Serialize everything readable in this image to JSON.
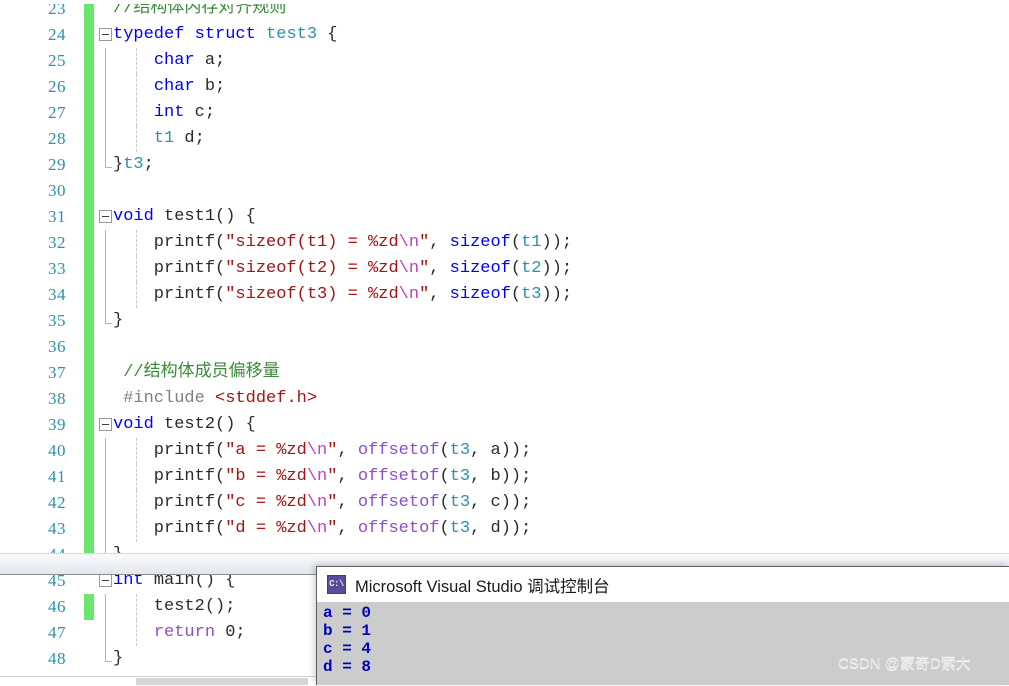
{
  "editor": {
    "first_visible_line": 23,
    "lines": [
      {
        "n": 23,
        "changed": true,
        "fold": false,
        "rail": "none",
        "guide": false,
        "tokens": [
          {
            "t": "//结构体内存对齐规则",
            "c": "cmt"
          }
        ],
        "indent": 0
      },
      {
        "n": 24,
        "changed": true,
        "fold": true,
        "rail": "none",
        "guide": false,
        "tokens": [
          {
            "t": "typedef",
            "c": "kw"
          },
          {
            "t": " ",
            "c": "pln"
          },
          {
            "t": "struct",
            "c": "kw"
          },
          {
            "t": " ",
            "c": "pln"
          },
          {
            "t": "test3",
            "c": "typ"
          },
          {
            "t": " {",
            "c": "pln"
          }
        ],
        "indent": 0
      },
      {
        "n": 25,
        "changed": true,
        "fold": false,
        "rail": "mid",
        "guide": true,
        "tokens": [
          {
            "t": "    ",
            "c": "pln"
          },
          {
            "t": "char",
            "c": "kw"
          },
          {
            "t": " a;",
            "c": "pln"
          }
        ],
        "indent": 0
      },
      {
        "n": 26,
        "changed": true,
        "fold": false,
        "rail": "mid",
        "guide": true,
        "tokens": [
          {
            "t": "    ",
            "c": "pln"
          },
          {
            "t": "char",
            "c": "kw"
          },
          {
            "t": " b;",
            "c": "pln"
          }
        ],
        "indent": 0
      },
      {
        "n": 27,
        "changed": true,
        "fold": false,
        "rail": "mid",
        "guide": true,
        "tokens": [
          {
            "t": "    ",
            "c": "pln"
          },
          {
            "t": "int",
            "c": "kw"
          },
          {
            "t": " c;",
            "c": "pln"
          }
        ],
        "indent": 0
      },
      {
        "n": 28,
        "changed": true,
        "fold": false,
        "rail": "mid",
        "guide": true,
        "tokens": [
          {
            "t": "    ",
            "c": "pln"
          },
          {
            "t": "t1",
            "c": "typ"
          },
          {
            "t": " d;",
            "c": "pln"
          }
        ],
        "indent": 0
      },
      {
        "n": 29,
        "changed": true,
        "fold": false,
        "rail": "end",
        "guide": false,
        "tokens": [
          {
            "t": "}",
            "c": "pln"
          },
          {
            "t": "t3",
            "c": "typ"
          },
          {
            "t": ";",
            "c": "pln"
          }
        ],
        "indent": 0
      },
      {
        "n": 30,
        "changed": true,
        "fold": false,
        "rail": "none",
        "guide": false,
        "tokens": [],
        "indent": 0
      },
      {
        "n": 31,
        "changed": true,
        "fold": true,
        "rail": "none",
        "guide": false,
        "tokens": [
          {
            "t": "void",
            "c": "kw"
          },
          {
            "t": " ",
            "c": "pln"
          },
          {
            "t": "test1",
            "c": "pln"
          },
          {
            "t": "() {",
            "c": "pln"
          }
        ],
        "indent": 0
      },
      {
        "n": 32,
        "changed": true,
        "fold": false,
        "rail": "mid",
        "guide": true,
        "tokens": [
          {
            "t": "    printf(",
            "c": "pln"
          },
          {
            "t": "\"sizeof(t1) = %zd",
            "c": "str"
          },
          {
            "t": "\\n",
            "c": "esc"
          },
          {
            "t": "\"",
            "c": "str"
          },
          {
            "t": ", ",
            "c": "pln"
          },
          {
            "t": "sizeof",
            "c": "kw"
          },
          {
            "t": "(",
            "c": "pln"
          },
          {
            "t": "t1",
            "c": "typ"
          },
          {
            "t": "));",
            "c": "pln"
          }
        ],
        "indent": 0
      },
      {
        "n": 33,
        "changed": true,
        "fold": false,
        "rail": "mid",
        "guide": true,
        "tokens": [
          {
            "t": "    printf(",
            "c": "pln"
          },
          {
            "t": "\"sizeof(t2) = %zd",
            "c": "str"
          },
          {
            "t": "\\n",
            "c": "esc"
          },
          {
            "t": "\"",
            "c": "str"
          },
          {
            "t": ", ",
            "c": "pln"
          },
          {
            "t": "sizeof",
            "c": "kw"
          },
          {
            "t": "(",
            "c": "pln"
          },
          {
            "t": "t2",
            "c": "typ"
          },
          {
            "t": "));",
            "c": "pln"
          }
        ],
        "indent": 0
      },
      {
        "n": 34,
        "changed": true,
        "fold": false,
        "rail": "mid",
        "guide": true,
        "tokens": [
          {
            "t": "    printf(",
            "c": "pln"
          },
          {
            "t": "\"sizeof(t3) = %zd",
            "c": "str"
          },
          {
            "t": "\\n",
            "c": "esc"
          },
          {
            "t": "\"",
            "c": "str"
          },
          {
            "t": ", ",
            "c": "pln"
          },
          {
            "t": "sizeof",
            "c": "kw"
          },
          {
            "t": "(",
            "c": "pln"
          },
          {
            "t": "t3",
            "c": "typ"
          },
          {
            "t": "));",
            "c": "pln"
          }
        ],
        "indent": 0
      },
      {
        "n": 35,
        "changed": true,
        "fold": false,
        "rail": "end",
        "guide": false,
        "tokens": [
          {
            "t": "}",
            "c": "pln"
          }
        ],
        "indent": 0
      },
      {
        "n": 36,
        "changed": true,
        "fold": false,
        "rail": "none",
        "guide": false,
        "tokens": [],
        "indent": 0
      },
      {
        "n": 37,
        "changed": true,
        "fold": false,
        "rail": "none",
        "guide": false,
        "tokens": [
          {
            "t": " //结构体成员偏移量",
            "c": "cmt"
          }
        ],
        "indent": 0
      },
      {
        "n": 38,
        "changed": true,
        "fold": false,
        "rail": "none",
        "guide": false,
        "tokens": [
          {
            "t": " #include",
            "c": "pre"
          },
          {
            "t": " <stddef.h>",
            "c": "prehdr"
          }
        ],
        "indent": 0
      },
      {
        "n": 39,
        "changed": true,
        "fold": true,
        "rail": "none",
        "guide": false,
        "tokens": [
          {
            "t": "void",
            "c": "kw"
          },
          {
            "t": " ",
            "c": "pln"
          },
          {
            "t": "test2",
            "c": "pln"
          },
          {
            "t": "() {",
            "c": "pln"
          }
        ],
        "indent": 0
      },
      {
        "n": 40,
        "changed": true,
        "fold": false,
        "rail": "mid",
        "guide": true,
        "tokens": [
          {
            "t": "    printf(",
            "c": "pln"
          },
          {
            "t": "\"a = %zd",
            "c": "str"
          },
          {
            "t": "\\n",
            "c": "esc"
          },
          {
            "t": "\"",
            "c": "str"
          },
          {
            "t": ", ",
            "c": "pln"
          },
          {
            "t": "offsetof",
            "c": "fn"
          },
          {
            "t": "(",
            "c": "pln"
          },
          {
            "t": "t3",
            "c": "typ"
          },
          {
            "t": ", a));",
            "c": "pln"
          }
        ],
        "indent": 0
      },
      {
        "n": 41,
        "changed": true,
        "fold": false,
        "rail": "mid",
        "guide": true,
        "tokens": [
          {
            "t": "    printf(",
            "c": "pln"
          },
          {
            "t": "\"b = %zd",
            "c": "str"
          },
          {
            "t": "\\n",
            "c": "esc"
          },
          {
            "t": "\"",
            "c": "str"
          },
          {
            "t": ", ",
            "c": "pln"
          },
          {
            "t": "offsetof",
            "c": "fn"
          },
          {
            "t": "(",
            "c": "pln"
          },
          {
            "t": "t3",
            "c": "typ"
          },
          {
            "t": ", b));",
            "c": "pln"
          }
        ],
        "indent": 0
      },
      {
        "n": 42,
        "changed": true,
        "fold": false,
        "rail": "mid",
        "guide": true,
        "tokens": [
          {
            "t": "    printf(",
            "c": "pln"
          },
          {
            "t": "\"c = %zd",
            "c": "str"
          },
          {
            "t": "\\n",
            "c": "esc"
          },
          {
            "t": "\"",
            "c": "str"
          },
          {
            "t": ", ",
            "c": "pln"
          },
          {
            "t": "offsetof",
            "c": "fn"
          },
          {
            "t": "(",
            "c": "pln"
          },
          {
            "t": "t3",
            "c": "typ"
          },
          {
            "t": ", c));",
            "c": "pln"
          }
        ],
        "indent": 0
      },
      {
        "n": 43,
        "changed": true,
        "fold": false,
        "rail": "mid",
        "guide": true,
        "tokens": [
          {
            "t": "    printf(",
            "c": "pln"
          },
          {
            "t": "\"d = %zd",
            "c": "str"
          },
          {
            "t": "\\n",
            "c": "esc"
          },
          {
            "t": "\"",
            "c": "str"
          },
          {
            "t": ", ",
            "c": "pln"
          },
          {
            "t": "offsetof",
            "c": "fn"
          },
          {
            "t": "(",
            "c": "pln"
          },
          {
            "t": "t3",
            "c": "typ"
          },
          {
            "t": ", d));",
            "c": "pln"
          }
        ],
        "indent": 0
      },
      {
        "n": 44,
        "changed": true,
        "fold": false,
        "rail": "end",
        "guide": false,
        "tokens": [
          {
            "t": "}",
            "c": "pln"
          }
        ],
        "indent": 0
      },
      {
        "n": 45,
        "changed": false,
        "fold": true,
        "rail": "none",
        "guide": false,
        "tokens": [
          {
            "t": "int",
            "c": "kw"
          },
          {
            "t": " ",
            "c": "pln"
          },
          {
            "t": "main",
            "c": "pln"
          },
          {
            "t": "() {",
            "c": "pln"
          }
        ],
        "indent": 0
      },
      {
        "n": 46,
        "changed": true,
        "fold": false,
        "rail": "mid",
        "guide": true,
        "tokens": [
          {
            "t": "    test2();",
            "c": "pln"
          }
        ],
        "indent": 0
      },
      {
        "n": 47,
        "changed": false,
        "fold": false,
        "rail": "mid",
        "guide": true,
        "tokens": [
          {
            "t": "    ",
            "c": "pln"
          },
          {
            "t": "return",
            "c": "fn"
          },
          {
            "t": " 0;",
            "c": "pln"
          }
        ],
        "indent": 0
      },
      {
        "n": 48,
        "changed": false,
        "fold": false,
        "rail": "end",
        "guide": false,
        "tokens": [
          {
            "t": "}",
            "c": "pln"
          }
        ],
        "indent": 0
      }
    ]
  },
  "console": {
    "title": "Microsoft Visual Studio 调试控制台",
    "icon_label": "C:\\",
    "output": [
      "a = 0",
      "b = 1",
      "c = 4",
      "d = 8"
    ]
  },
  "watermark": {
    "text": "CSDN @蒙奇D索大"
  },
  "colors": {
    "change_bar": "#6ce66c",
    "keyword": "#0000ff",
    "type": "#2b91af",
    "comment": "#3c8a3c",
    "string": "#a31515",
    "escape": "#c040c0",
    "function": "#8f4fc9",
    "line_number": "#2b91af",
    "console_bg": "#cccccc",
    "console_text": "#0000c0"
  }
}
